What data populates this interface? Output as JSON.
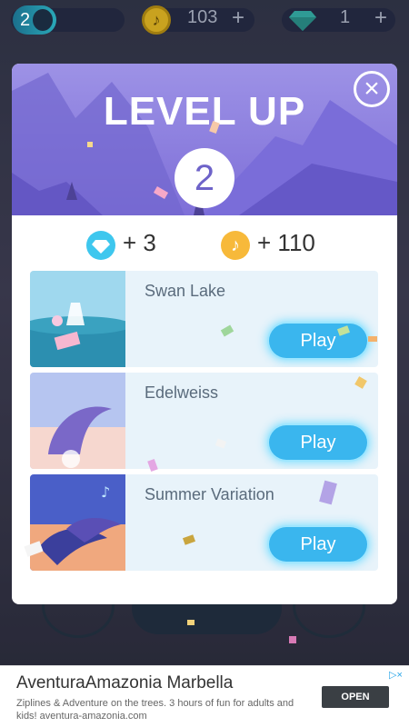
{
  "hud": {
    "level": "2",
    "coins": "103",
    "coins_plus": "+",
    "gems": "1",
    "gems_plus": "+",
    "coin_icon": "♪"
  },
  "modal": {
    "title": "LEVEL UP",
    "level": "2",
    "close_icon": "×",
    "rewards": {
      "gems": "+ 3",
      "notes": "+ 110",
      "note_icon": "♪"
    },
    "songs": [
      {
        "title": "Swan Lake",
        "play_label": "Play"
      },
      {
        "title": "Edelweiss",
        "play_label": "Play"
      },
      {
        "title": "Summer Variation",
        "play_label": "Play"
      }
    ]
  },
  "ad": {
    "title": "AventuraAmazonia Marbella",
    "description": "Ziplines & Adventure on the trees. 3 hours of fun for adults and kids! aventura-amazonia.com",
    "button": "OPEN",
    "choice_icon": "▷×"
  },
  "colors": {
    "accent": "#3ab6ee",
    "banner": "#8a7fe0",
    "coin": "#f7b93a",
    "gem": "#3ec7ee"
  }
}
